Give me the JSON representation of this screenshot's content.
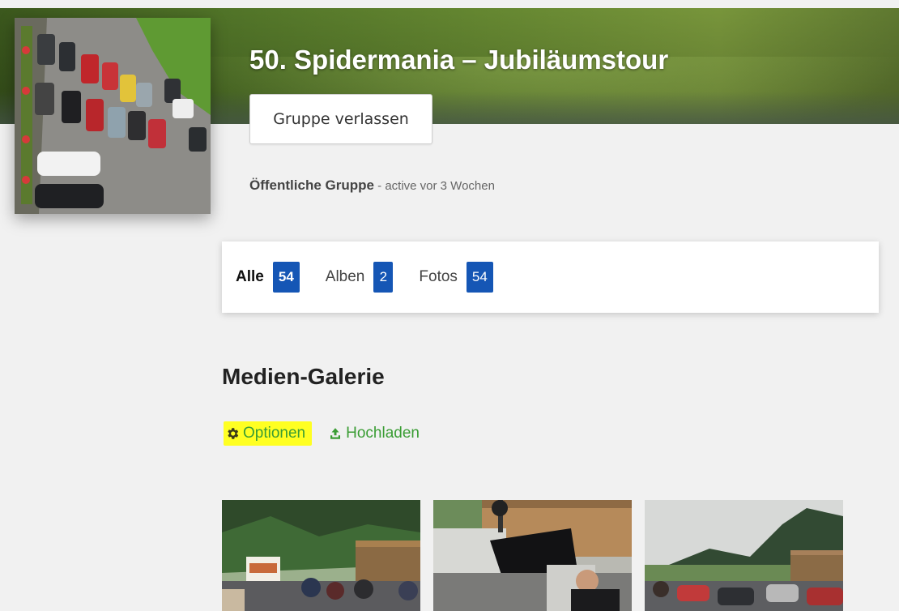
{
  "group": {
    "title": "50. Spidermania – Jubiläumstour",
    "leave_label": "Gruppe verlassen",
    "type_label": "Öffentliche Gruppe",
    "separator": " - ",
    "activity": "active vor 3 Wochen"
  },
  "tabs": [
    {
      "label": "Alle",
      "count": "54",
      "active": true
    },
    {
      "label": "Alben",
      "count": "2",
      "active": false
    },
    {
      "label": "Fotos",
      "count": "54",
      "active": false
    }
  ],
  "gallery": {
    "title": "Medien-Galerie",
    "options_label": "Optionen",
    "upload_label": "Hochladen",
    "options_icon": "gear-icon",
    "upload_icon": "upload-icon"
  },
  "colors": {
    "accent": "#1556b5",
    "link": "#3a9d34",
    "highlight": "#ffff22"
  }
}
